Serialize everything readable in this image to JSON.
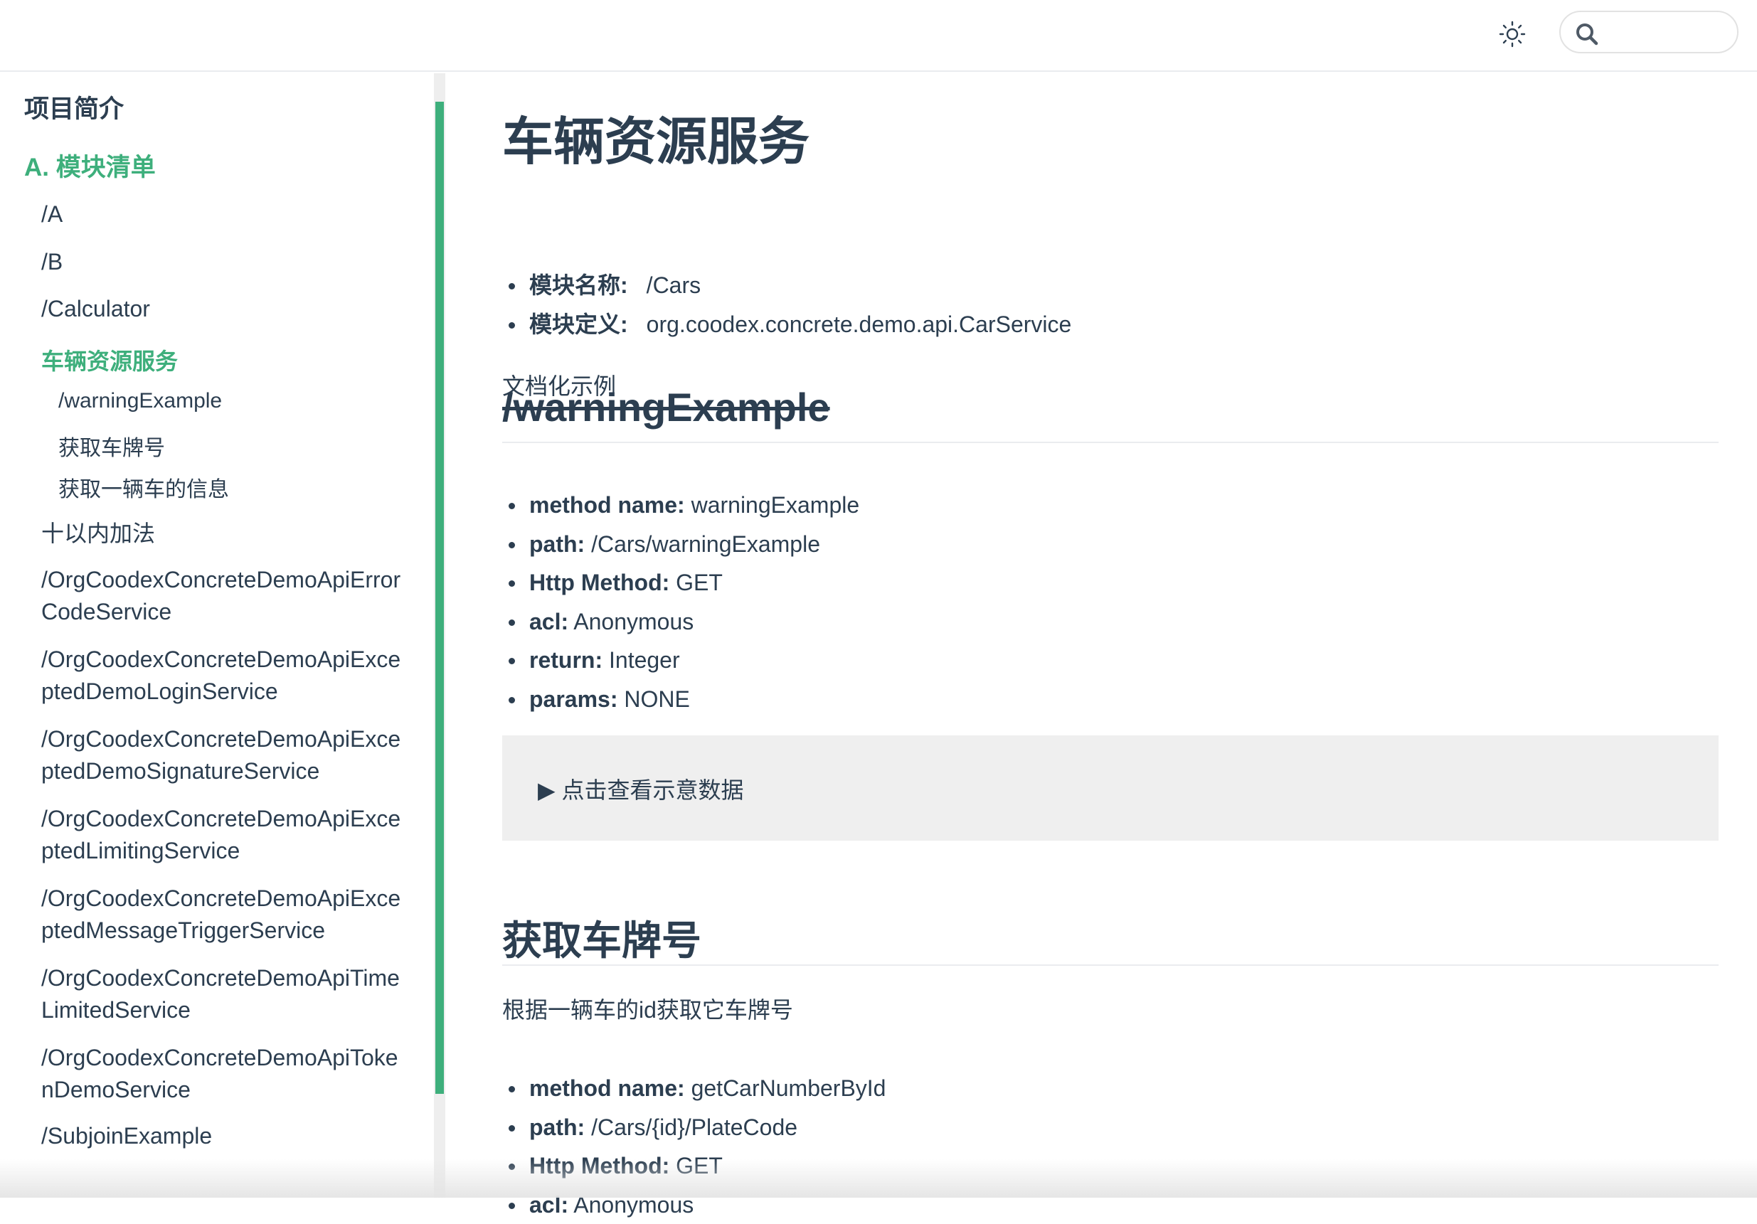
{
  "navbar": {
    "theme_icon": "sun-icon",
    "search_icon": "search-icon",
    "search_value": "",
    "search_placeholder": ""
  },
  "sidebar": {
    "heading_intro": "项目简介",
    "heading_modules": "A. 模块清单",
    "items": [
      {
        "label": "/A"
      },
      {
        "label": "/B"
      },
      {
        "label": "/Calculator"
      },
      {
        "label": "车辆资源服务"
      },
      {
        "label": "十以内加法"
      },
      {
        "label_line1": "/OrgCoodexConcreteDemoApiError",
        "label_line2": "CodeService"
      },
      {
        "label_line1": "/OrgCoodexConcreteDemoApiExce",
        "label_line2": "ptedDemoLoginService"
      },
      {
        "label_line1": "/OrgCoodexConcreteDemoApiExce",
        "label_line2": "ptedDemoSignatureService"
      },
      {
        "label_line1": "/OrgCoodexConcreteDemoApiExce",
        "label_line2": "ptedLimitingService"
      },
      {
        "label_line1": "/OrgCoodexConcreteDemoApiExce",
        "label_line2": "ptedMessageTriggerService"
      },
      {
        "label_line1": "/OrgCoodexConcreteDemoApiTime",
        "label_line2": "LimitedService"
      },
      {
        "label_line1": "/OrgCoodexConcreteDemoApiToke",
        "label_line2": "nDemoService"
      },
      {
        "label": "/SubjoinExample"
      }
    ],
    "sub_items": [
      {
        "label": "/warningExample"
      },
      {
        "label": "获取车牌号"
      },
      {
        "label": "获取一辆车的信息"
      }
    ]
  },
  "content": {
    "title": "车辆资源服务",
    "module_name_label": "模块名称:",
    "module_name_value": "/Cars",
    "module_def_label": "模块定义:",
    "module_def_value": "org.coodex.concrete.demo.api.CarService",
    "description": "文档化示例",
    "sections": [
      {
        "heading": "/warningExample",
        "deprecated": true,
        "props": [
          {
            "key": "method name:",
            "value": " warningExample"
          },
          {
            "key": "path:",
            "value": " /Cars/warningExample"
          },
          {
            "key": "Http Method:",
            "value": " GET"
          },
          {
            "key": "acl:",
            "value": " Anonymous"
          },
          {
            "key": "return:",
            "value": " Integer"
          },
          {
            "key": "params:",
            "value": " NONE"
          }
        ],
        "details_summary": "▶ 点击查看示意数据"
      },
      {
        "heading": "获取车牌号",
        "deprecated": false,
        "description": "根据一辆车的id获取它车牌号",
        "props": [
          {
            "key": "method name:",
            "value": " getCarNumberById"
          },
          {
            "key": "path:",
            "value": " /Cars/{id}/PlateCode"
          },
          {
            "key": "Http Method:",
            "value": " GET"
          },
          {
            "key": "acl:",
            "value": " Anonymous"
          }
        ]
      }
    ]
  },
  "colors": {
    "accent": "#3eaf7c",
    "text": "#2c3e50",
    "border": "#eaecef",
    "details_bg": "#efefef"
  }
}
